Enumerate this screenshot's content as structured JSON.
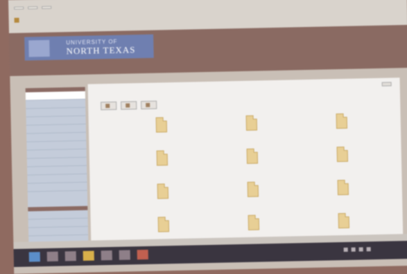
{
  "browser": {
    "tabs": [
      "",
      "",
      ""
    ],
    "top_links": [
      "",
      "",
      ""
    ]
  },
  "banner": {
    "logo_line1": "UNIVERSITY OF",
    "logo_line2": "NORTH TEXAS",
    "title": "",
    "subtitle": ""
  },
  "nav": {
    "header": "",
    "items": [
      "",
      "",
      "",
      "",
      "",
      "",
      "",
      "",
      "",
      "",
      "",
      ""
    ],
    "section2_header": "",
    "section2_items": [
      "",
      "",
      ""
    ]
  },
  "main": {
    "breadcrumb": "",
    "page_options": "",
    "toolbar": [
      "",
      "",
      ""
    ],
    "files": [
      "",
      "",
      "",
      "",
      "",
      "",
      "",
      "",
      "",
      "",
      "",
      ""
    ]
  },
  "taskbar": {
    "clock": ""
  },
  "colors": {
    "banner": "#8a6a62",
    "logo_bg": "#6f7fb0",
    "nav_bg": "#c4ccda",
    "file_icon": "#e8cf95"
  }
}
